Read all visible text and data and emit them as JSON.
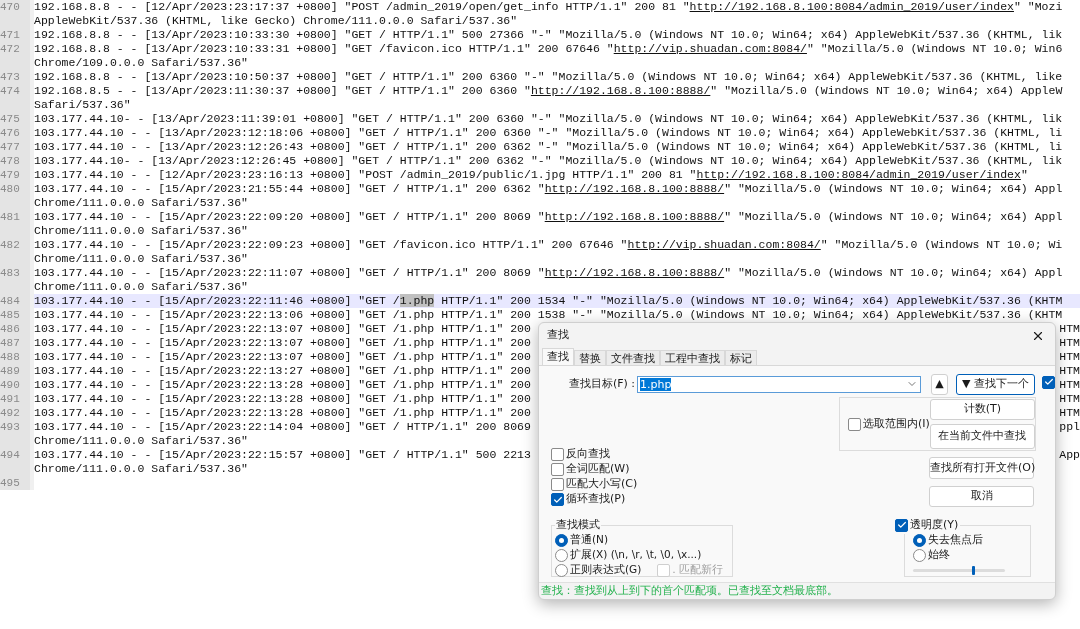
{
  "editor": {
    "lines": [
      {
        "number": "470",
        "current": false,
        "rows": [
          {
            "segments": [
              {
                "kind": "text",
                "text": "192.168.8.8 - - [12/Apr/2023:23:17:37 +0800] \"POST /admin_2019/open/get_info HTTP/1.1\" 200 81 \""
              },
              {
                "kind": "link",
                "text": "http://192.168.8.100:8084/admin_2019/user/index"
              },
              {
                "kind": "text",
                "text": "\" \"Mozi"
              }
            ]
          },
          {
            "segments": [
              {
                "kind": "text",
                "text": "AppleWebKit/537.36 (KHTML, like Gecko) Chrome/111.0.0.0 Safari/537.36\""
              }
            ]
          }
        ]
      },
      {
        "number": "471",
        "current": false,
        "rows": [
          {
            "segments": [
              {
                "kind": "text",
                "text": "192.168.8.8 - - [13/Apr/2023:10:33:30 +0800] \"GET / HTTP/1.1\" 500 27366 \"-\" \"Mozilla/5.0 (Windows NT 10.0; Win64; x64) AppleWebKit/537.36 (KHTML, lik"
              }
            ]
          }
        ]
      },
      {
        "number": "472",
        "current": false,
        "rows": [
          {
            "segments": [
              {
                "kind": "text",
                "text": "192.168.8.8 - - [13/Apr/2023:10:33:31 +0800] \"GET /favicon.ico HTTP/1.1\" 200 67646 \""
              },
              {
                "kind": "link",
                "text": "http://vip.shuadan.com:8084/"
              },
              {
                "kind": "text",
                "text": "\" \"Mozilla/5.0 (Windows NT 10.0; Win6"
              }
            ]
          },
          {
            "segments": [
              {
                "kind": "text",
                "text": "Chrome/109.0.0.0 Safari/537.36\""
              }
            ]
          }
        ]
      },
      {
        "number": "473",
        "current": false,
        "rows": [
          {
            "segments": [
              {
                "kind": "text",
                "text": "192.168.8.8 - - [13/Apr/2023:10:50:37 +0800] \"GET / HTTP/1.1\" 200 6360 \"-\" \"Mozilla/5.0 (Windows NT 10.0; Win64; x64) AppleWebKit/537.36 (KHTML, like"
              }
            ]
          }
        ]
      },
      {
        "number": "474",
        "current": false,
        "rows": [
          {
            "segments": [
              {
                "kind": "text",
                "text": "192.168.8.5 - - [13/Apr/2023:11:30:37 +0800] \"GET / HTTP/1.1\" 200 6360 \""
              },
              {
                "kind": "link",
                "text": "http://192.168.8.100:8888/"
              },
              {
                "kind": "text",
                "text": "\" \"Mozilla/5.0 (Windows NT 10.0; Win64; x64) AppleW"
              }
            ]
          },
          {
            "segments": [
              {
                "kind": "text",
                "text": "Safari/537.36\""
              }
            ]
          }
        ]
      },
      {
        "number": "475",
        "current": false,
        "rows": [
          {
            "segments": [
              {
                "kind": "text",
                "text": "103.177.44.10- - [13/Apr/2023:11:39:01 +0800] \"GET / HTTP/1.1\" 200 6360 \"-\" \"Mozilla/5.0 (Windows NT 10.0; Win64; x64) AppleWebKit/537.36 (KHTML, lik"
              }
            ]
          }
        ]
      },
      {
        "number": "476",
        "current": false,
        "rows": [
          {
            "segments": [
              {
                "kind": "text",
                "text": "103.177.44.10 - - [13/Apr/2023:12:18:06 +0800] \"GET / HTTP/1.1\" 200 6360 \"-\" \"Mozilla/5.0 (Windows NT 10.0; Win64; x64) AppleWebKit/537.36 (KHTML, li"
              }
            ]
          }
        ]
      },
      {
        "number": "477",
        "current": false,
        "rows": [
          {
            "segments": [
              {
                "kind": "text",
                "text": "103.177.44.10 - - [13/Apr/2023:12:26:43 +0800] \"GET / HTTP/1.1\" 200 6362 \"-\" \"Mozilla/5.0 (Windows NT 10.0; Win64; x64) AppleWebKit/537.36 (KHTML, li"
              }
            ]
          }
        ]
      },
      {
        "number": "478",
        "current": false,
        "rows": [
          {
            "segments": [
              {
                "kind": "text",
                "text": "103.177.44.10- - [13/Apr/2023:12:26:45 +0800] \"GET / HTTP/1.1\" 200 6362 \"-\" \"Mozilla/5.0 (Windows NT 10.0; Win64; x64) AppleWebKit/537.36 (KHTML, lik"
              }
            ]
          }
        ]
      },
      {
        "number": "479",
        "current": false,
        "rows": [
          {
            "segments": [
              {
                "kind": "text",
                "text": "103.177.44.10 - - [12/Apr/2023:23:16:13 +0800] \"POST /admin_2019/public/1.jpg HTTP/1.1\" 200 81 \""
              },
              {
                "kind": "link",
                "text": "http://192.168.8.100:8084/admin_2019/user/index"
              },
              {
                "kind": "text",
                "text": "\""
              }
            ]
          }
        ]
      },
      {
        "number": "480",
        "current": false,
        "rows": [
          {
            "segments": [
              {
                "kind": "text",
                "text": "103.177.44.10 - - [15/Apr/2023:21:55:44 +0800] \"GET / HTTP/1.1\" 200 6362 \""
              },
              {
                "kind": "link",
                "text": "http://192.168.8.100:8888/"
              },
              {
                "kind": "text",
                "text": "\" \"Mozilla/5.0 (Windows NT 10.0; Win64; x64) Appl"
              }
            ]
          },
          {
            "segments": [
              {
                "kind": "text",
                "text": "Chrome/111.0.0.0 Safari/537.36\""
              }
            ]
          }
        ]
      },
      {
        "number": "481",
        "current": false,
        "rows": [
          {
            "segments": [
              {
                "kind": "text",
                "text": "103.177.44.10 - - [15/Apr/2023:22:09:20 +0800] \"GET / HTTP/1.1\" 200 8069 \""
              },
              {
                "kind": "link",
                "text": "http://192.168.8.100:8888/"
              },
              {
                "kind": "text",
                "text": "\" \"Mozilla/5.0 (Windows NT 10.0; Win64; x64) Appl"
              }
            ]
          },
          {
            "segments": [
              {
                "kind": "text",
                "text": "Chrome/111.0.0.0 Safari/537.36\""
              }
            ]
          }
        ]
      },
      {
        "number": "482",
        "current": false,
        "rows": [
          {
            "segments": [
              {
                "kind": "text",
                "text": "103.177.44.10 - - [15/Apr/2023:22:09:23 +0800] \"GET /favicon.ico HTTP/1.1\" 200 67646 \""
              },
              {
                "kind": "link",
                "text": "http://vip.shuadan.com:8084/"
              },
              {
                "kind": "text",
                "text": "\" \"Mozilla/5.0 (Windows NT 10.0; Wi"
              }
            ]
          },
          {
            "segments": [
              {
                "kind": "text",
                "text": "Chrome/111.0.0.0 Safari/537.36\""
              }
            ]
          }
        ]
      },
      {
        "number": "483",
        "current": false,
        "rows": [
          {
            "segments": [
              {
                "kind": "text",
                "text": "103.177.44.10 - - [15/Apr/2023:22:11:07 +0800] \"GET / HTTP/1.1\" 200 8069 \""
              },
              {
                "kind": "link",
                "text": "http://192.168.8.100:8888/"
              },
              {
                "kind": "text",
                "text": "\" \"Mozilla/5.0 (Windows NT 10.0; Win64; x64) Appl"
              }
            ]
          },
          {
            "segments": [
              {
                "kind": "text",
                "text": "Chrome/111.0.0.0 Safari/537.36\""
              }
            ]
          }
        ]
      },
      {
        "number": "484",
        "current": true,
        "rows": [
          {
            "segments": [
              {
                "kind": "text",
                "text": "103.177.44.10 - - [15/Apr/2023:22:11:46 +0800] \"GET /"
              },
              {
                "kind": "match",
                "text": "1.php"
              },
              {
                "kind": "text",
                "text": " HTTP/1.1\" 200 1534 \"-\" \"Mozilla/5.0 (Windows NT 10.0; Win64; x64) AppleWebKit/537.36 (KHTM"
              }
            ]
          }
        ]
      },
      {
        "number": "485",
        "current": false,
        "rows": [
          {
            "segments": [
              {
                "kind": "text",
                "text": "103.177.44.10 - - [15/Apr/2023:22:13:06 +0800] \"GET /1.php HTTP/1.1\" 200 1538 \"-\" \"Mozilla/5.0 (Windows NT 10.0; Win64; x64) AppleWebKit/537.36 (KHTM"
              }
            ]
          }
        ]
      },
      {
        "number": "486",
        "current": false,
        "rows": [
          {
            "segments": [
              {
                "kind": "text",
                "text": "103.177.44.10 - - [15/Apr/2023:22:13:07 +0800] \"GET /1.php HTTP/1.1\" 200"
              }
            ],
            "tail": "HTM"
          }
        ]
      },
      {
        "number": "487",
        "current": false,
        "rows": [
          {
            "segments": [
              {
                "kind": "text",
                "text": "103.177.44.10 - - [15/Apr/2023:22:13:07 +0800] \"GET /1.php HTTP/1.1\" 200"
              }
            ],
            "tail": "HTM"
          }
        ]
      },
      {
        "number": "488",
        "current": false,
        "rows": [
          {
            "segments": [
              {
                "kind": "text",
                "text": "103.177.44.10 - - [15/Apr/2023:22:13:07 +0800] \"GET /1.php HTTP/1.1\" 200"
              }
            ],
            "tail": "HTM"
          }
        ]
      },
      {
        "number": "489",
        "current": false,
        "rows": [
          {
            "segments": [
              {
                "kind": "text",
                "text": "103.177.44.10 - - [15/Apr/2023:22:13:27 +0800] \"GET /1.php HTTP/1.1\" 200"
              }
            ],
            "tail": "HTM"
          }
        ]
      },
      {
        "number": "490",
        "current": false,
        "rows": [
          {
            "segments": [
              {
                "kind": "text",
                "text": "103.177.44.10 - - [15/Apr/2023:22:13:28 +0800] \"GET /1.php HTTP/1.1\" 200"
              }
            ],
            "tail": "HTM"
          }
        ]
      },
      {
        "number": "491",
        "current": false,
        "rows": [
          {
            "segments": [
              {
                "kind": "text",
                "text": "103.177.44.10 - - [15/Apr/2023:22:13:28 +0800] \"GET /1.php HTTP/1.1\" 200"
              }
            ],
            "tail": "HTM"
          }
        ]
      },
      {
        "number": "492",
        "current": false,
        "rows": [
          {
            "segments": [
              {
                "kind": "text",
                "text": "103.177.44.10 - - [15/Apr/2023:22:13:28 +0800] \"GET /1.php HTTP/1.1\" 200"
              }
            ],
            "tail": "HTM"
          }
        ]
      },
      {
        "number": "493",
        "current": false,
        "rows": [
          {
            "segments": [
              {
                "kind": "text",
                "text": "103.177.44.10 - - [15/Apr/2023:22:14:04 +0800] \"GET / HTTP/1.1\" 200 8069"
              }
            ],
            "tail": "ppl"
          },
          {
            "segments": [
              {
                "kind": "text",
                "text": "Chrome/111.0.0.0 Safari/537.36\""
              }
            ]
          }
        ]
      },
      {
        "number": "494",
        "current": false,
        "rows": [
          {
            "segments": [
              {
                "kind": "text",
                "text": "103.177.44.10 - - [15/Apr/2023:22:15:57 +0800] \"GET / HTTP/1.1\" 500 2213"
              }
            ],
            "tail": "App"
          },
          {
            "segments": [
              {
                "kind": "text",
                "text": "Chrome/111.0.0.0 Safari/537.36\""
              }
            ]
          }
        ]
      },
      {
        "number": "495",
        "current": false,
        "rows": [
          {
            "segments": []
          }
        ]
      }
    ]
  },
  "find_dialog": {
    "title": "查找",
    "tabs": [
      {
        "label": "查找",
        "selected": true
      },
      {
        "label": "替换",
        "selected": false
      },
      {
        "label": "文件查找",
        "selected": false
      },
      {
        "label": "工程中查找",
        "selected": false
      },
      {
        "label": "标记",
        "selected": false
      }
    ],
    "target_label": "查找目标(F) :",
    "target_value": "1.php",
    "up_button": "▲",
    "find_next_button": "▼ 查找下一个",
    "side_checkbox": {
      "checked": true
    },
    "in_selection": {
      "label": "选取范围内(I)",
      "checked": false
    },
    "count_button": "计数(T)",
    "find_in_current_button": "在当前文件中查找",
    "find_all_open_button": "查找所有打开文件(O)",
    "cancel_button": "取消",
    "options": [
      {
        "label": "反向查找",
        "checked": false
      },
      {
        "label": "全词匹配(W)",
        "checked": false
      },
      {
        "label": "匹配大小写(C)",
        "checked": false
      },
      {
        "label": "循环查找(P)",
        "checked": true
      }
    ],
    "search_mode": {
      "title": "查找模式",
      "modes": [
        {
          "label": "普通(N)",
          "selected": true
        },
        {
          "label": "扩展(X) (\\n, \\r, \\t, \\0, \\x...)",
          "selected": false
        },
        {
          "label": "正则表达式(G)",
          "selected": false
        }
      ],
      "dot_newline": {
        "label": ". 匹配新行",
        "checked": false,
        "disabled": true
      }
    },
    "transparency": {
      "label": "透明度(Y)",
      "checked": true,
      "modes": [
        {
          "label": "失去焦点后",
          "selected": true
        },
        {
          "label": "始终",
          "selected": false
        }
      ],
      "level": 0.66
    },
    "status": "查找：查找到从上到下的首个匹配项。已查找至文档最底部。"
  }
}
